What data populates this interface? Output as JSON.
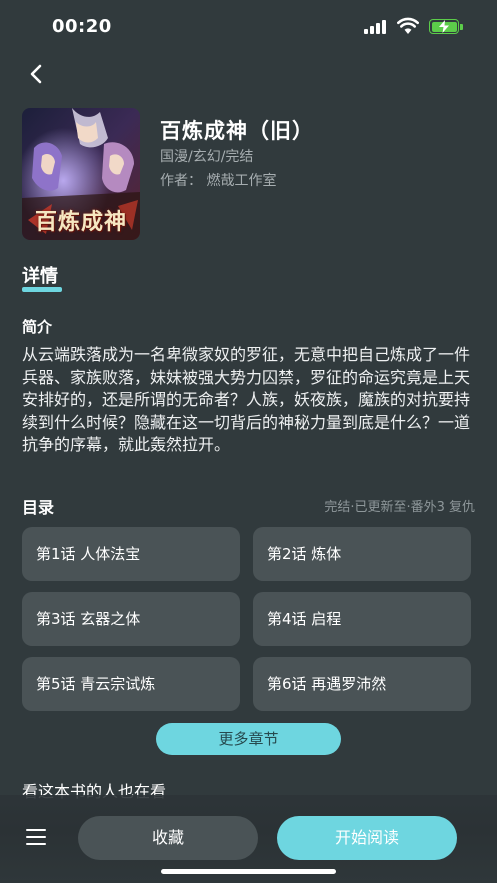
{
  "status_bar": {
    "time": "00:20",
    "signal_icon": "cellular-signal-icon",
    "wifi_icon": "wifi-icon",
    "battery_icon": "battery-charging-icon",
    "battery_color": "#5ccc4a"
  },
  "nav": {
    "back_icon": "chevron-left-icon"
  },
  "book": {
    "cover_title_text": "百炼成神",
    "title": "百炼成神（旧）",
    "tags": "国漫/玄幻/完结",
    "author": "作者：  燃哉工作室"
  },
  "tabs": {
    "detail_label": "详情"
  },
  "intro": {
    "heading": "简介",
    "text": "从云端跌落成为一名卑微家奴的罗征，无意中把自己炼成了一件兵器、家族败落，妹妹被强大势力囚禁，罗征的命运究竟是上天安排好的，还是所谓的无命者？人族，妖夜族，魔族的对抗要持续到什么时候？隐藏在这一切背后的神秘力量到底是什么？一道抗争的序幕，就此轰然拉开。"
  },
  "toc": {
    "heading": "目录",
    "status": "完结·已更新至·番外3 复仇",
    "chapters": [
      {
        "label": "第1话 人体法宝"
      },
      {
        "label": "第2话 炼体"
      },
      {
        "label": "第3话 玄器之体"
      },
      {
        "label": "第4话 启程"
      },
      {
        "label": "第5话 青云宗试炼"
      },
      {
        "label": "第6话 再遇罗沛然"
      }
    ],
    "more_label": "更多章节"
  },
  "also_read": {
    "heading": "看这本书的人也在看"
  },
  "bottom_bar": {
    "menu_icon": "menu-icon",
    "favorite_label": "收藏",
    "read_label": "开始阅读"
  },
  "colors": {
    "background": "#313a3d",
    "accent": "#6ed6e0",
    "card": "#4a5356"
  }
}
